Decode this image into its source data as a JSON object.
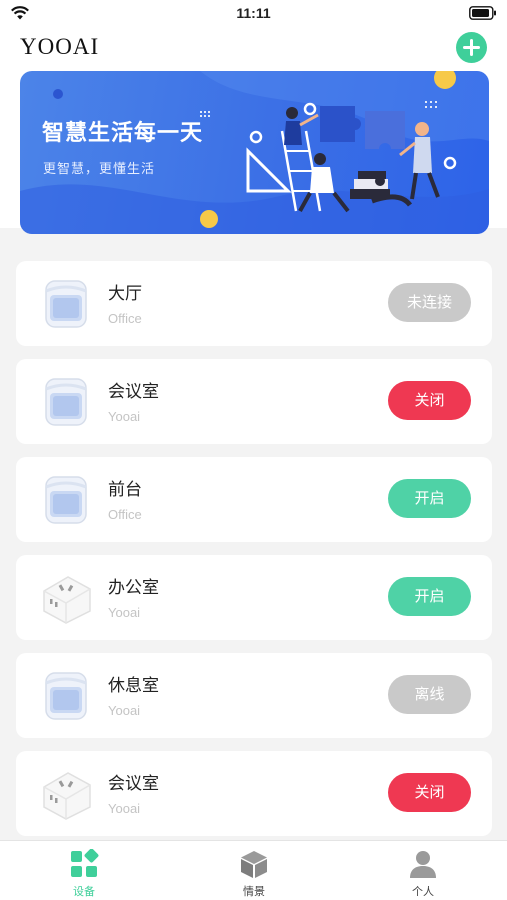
{
  "status_bar": {
    "time": "11:11"
  },
  "header": {
    "title": "YOOAI"
  },
  "banner": {
    "title": "智慧生活每一天",
    "subtitle": "更智慧，更懂生活"
  },
  "devices": [
    {
      "name": "大厅",
      "owner": "Office",
      "status": "未连接",
      "state": "disconnected",
      "icon": "cube-plug-icon"
    },
    {
      "name": "会议室",
      "owner": "Yooai",
      "status": "关闭",
      "state": "off",
      "icon": "cube-plug-icon"
    },
    {
      "name": "前台",
      "owner": "Office",
      "status": "开启",
      "state": "on",
      "icon": "cube-plug-icon"
    },
    {
      "name": "办公室",
      "owner": "Yooai",
      "status": "开启",
      "state": "on",
      "icon": "socket-plug-icon"
    },
    {
      "name": "休息室",
      "owner": "Yooai",
      "status": "离线",
      "state": "offline",
      "icon": "cube-plug-icon"
    },
    {
      "name": "会议室",
      "owner": "Yooai",
      "status": "关闭",
      "state": "off",
      "icon": "socket-plug-icon"
    }
  ],
  "tabs": [
    {
      "label": "设备",
      "icon": "devices-icon",
      "active": true
    },
    {
      "label": "情景",
      "icon": "scene-cube-icon",
      "active": false
    },
    {
      "label": "个人",
      "icon": "person-icon",
      "active": false
    }
  ],
  "colors": {
    "accent": "#3fcf9a",
    "off": "#ef3852",
    "on": "#4fd2a6",
    "inactive": "#c9c9c9",
    "banner": "#3b6fe6"
  }
}
